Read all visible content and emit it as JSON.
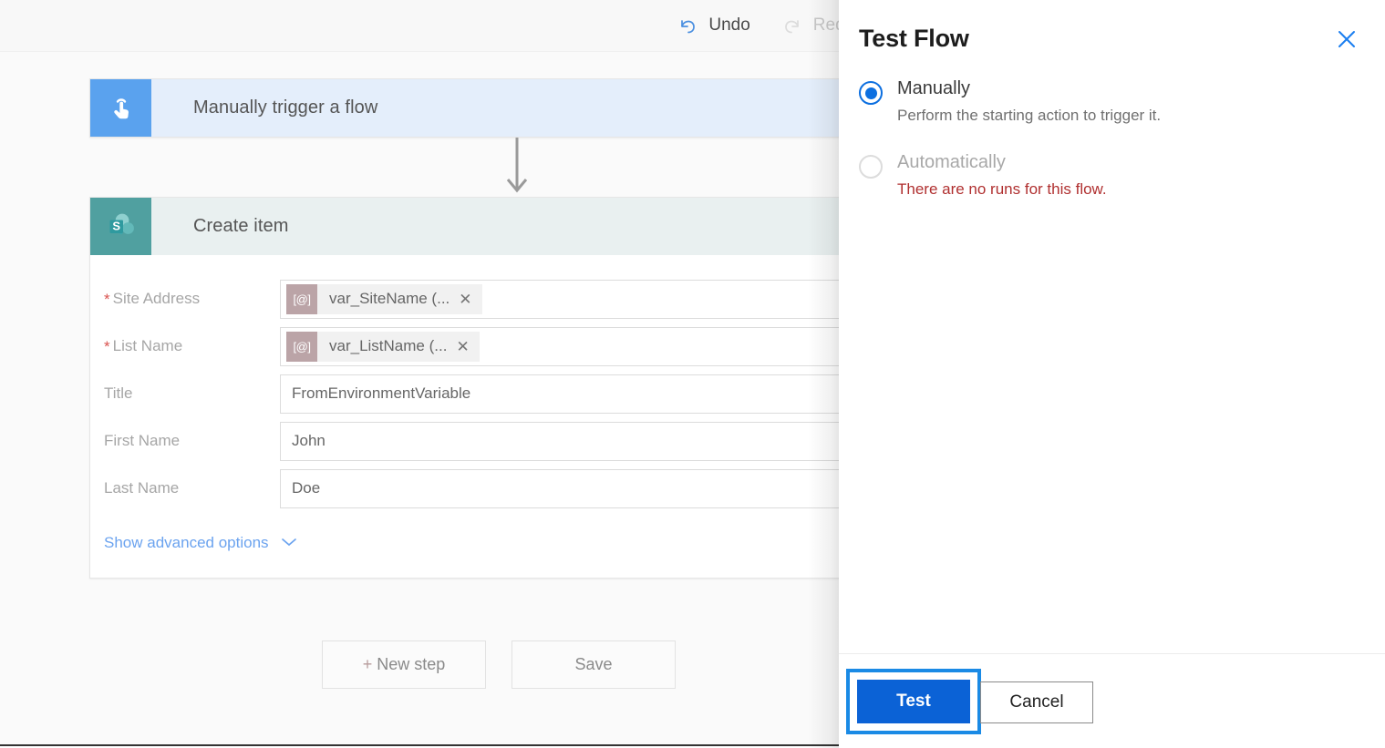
{
  "toolbar": {
    "undo_label": "Undo",
    "redo_label": "Red",
    "undo_icon": "undo-arrow-icon",
    "redo_icon": "redo-arrow-icon"
  },
  "flow": {
    "trigger": {
      "title": "Manually trigger a flow",
      "icon": "tap-hand-icon",
      "icon_color": "#5aa2ee",
      "header_color": "#e4eefb"
    },
    "action": {
      "title": "Create item",
      "icon": "sharepoint-icon",
      "icon_color": "#50a0a0",
      "header_color": "#e9f0f0"
    },
    "connector_icon": "down-arrow-icon",
    "fields": [
      {
        "label": "Site Address",
        "required": true,
        "type": "token",
        "token_prefix": "[@]",
        "value": "var_SiteName (...",
        "remove_icon": "close-small-icon"
      },
      {
        "label": "List Name",
        "required": true,
        "type": "token",
        "token_prefix": "[@]",
        "value": "var_ListName (...",
        "remove_icon": "close-small-icon"
      },
      {
        "label": "Title",
        "required": false,
        "type": "text",
        "value": "FromEnvironmentVariable"
      },
      {
        "label": "First Name",
        "required": false,
        "type": "text",
        "value": "John"
      },
      {
        "label": "Last Name",
        "required": false,
        "type": "text",
        "value": "Doe"
      }
    ],
    "advanced_options_label": "Show advanced options",
    "advanced_options_icon": "chevron-down-icon"
  },
  "bottom_actions": {
    "new_step_plus": "+",
    "new_step_label": "New step",
    "save_label": "Save"
  },
  "panel": {
    "title": "Test Flow",
    "close_icon": "close-icon",
    "options": [
      {
        "label": "Manually",
        "description": "Perform the starting action to trigger it.",
        "selected": true,
        "disabled": false
      },
      {
        "label": "Automatically",
        "description": "There are no runs for this flow.",
        "selected": false,
        "disabled": true
      }
    ],
    "footer": {
      "test_label": "Test",
      "cancel_label": "Cancel"
    }
  },
  "colors": {
    "accent_blue": "#0b62d6",
    "focus_blue": "#1a8ae5",
    "error_red": "#b03030",
    "required_red": "#d9534f",
    "link_blue": "#6ba3ef"
  }
}
